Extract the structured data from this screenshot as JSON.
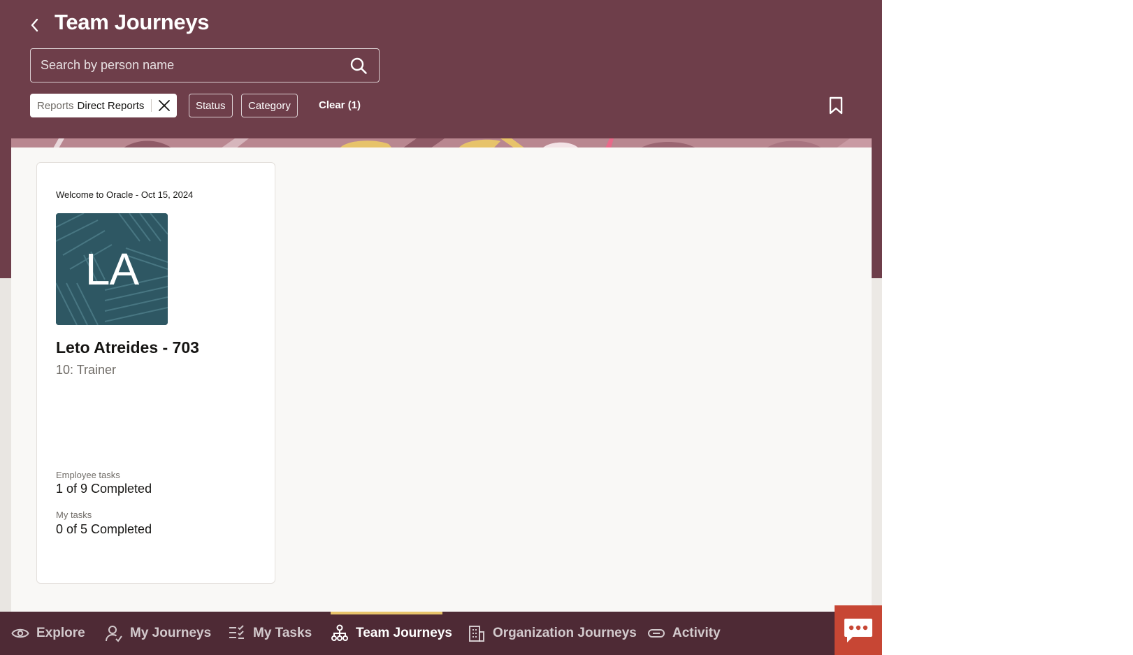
{
  "header": {
    "title": "Team Journeys",
    "search_placeholder": "Search by person name",
    "filters": {
      "active_chip_label": "Reports",
      "active_chip_value": "Direct Reports",
      "status_label": "Status",
      "category_label": "Category",
      "clear_label": "Clear (1)"
    }
  },
  "card": {
    "journey": "Welcome to Oracle - Oct 15, 2024",
    "initials": "LA",
    "name": "Leto Atreides - 703",
    "role": "10: Trainer",
    "employee_tasks_label": "Employee tasks",
    "employee_tasks_value": "1 of 9 Completed",
    "my_tasks_label": "My tasks",
    "my_tasks_value": "0 of 5 Completed"
  },
  "nav": {
    "items": [
      {
        "label": "Explore",
        "icon": "eye-icon"
      },
      {
        "label": "My Journeys",
        "icon": "person-icon"
      },
      {
        "label": "My Tasks",
        "icon": "checklist-icon"
      },
      {
        "label": "Team Journeys",
        "icon": "org-chart-icon"
      },
      {
        "label": "Organization Journeys",
        "icon": "building-icon"
      },
      {
        "label": "Activity",
        "icon": "link-icon"
      }
    ],
    "active": "Team Journeys"
  },
  "colors": {
    "header_bg": "#6e3e4a",
    "nav_bg": "#4e2a35",
    "active_indicator": "#e7c36a",
    "chat_button": "#c74634",
    "avatar_bg": "#2e5763"
  }
}
